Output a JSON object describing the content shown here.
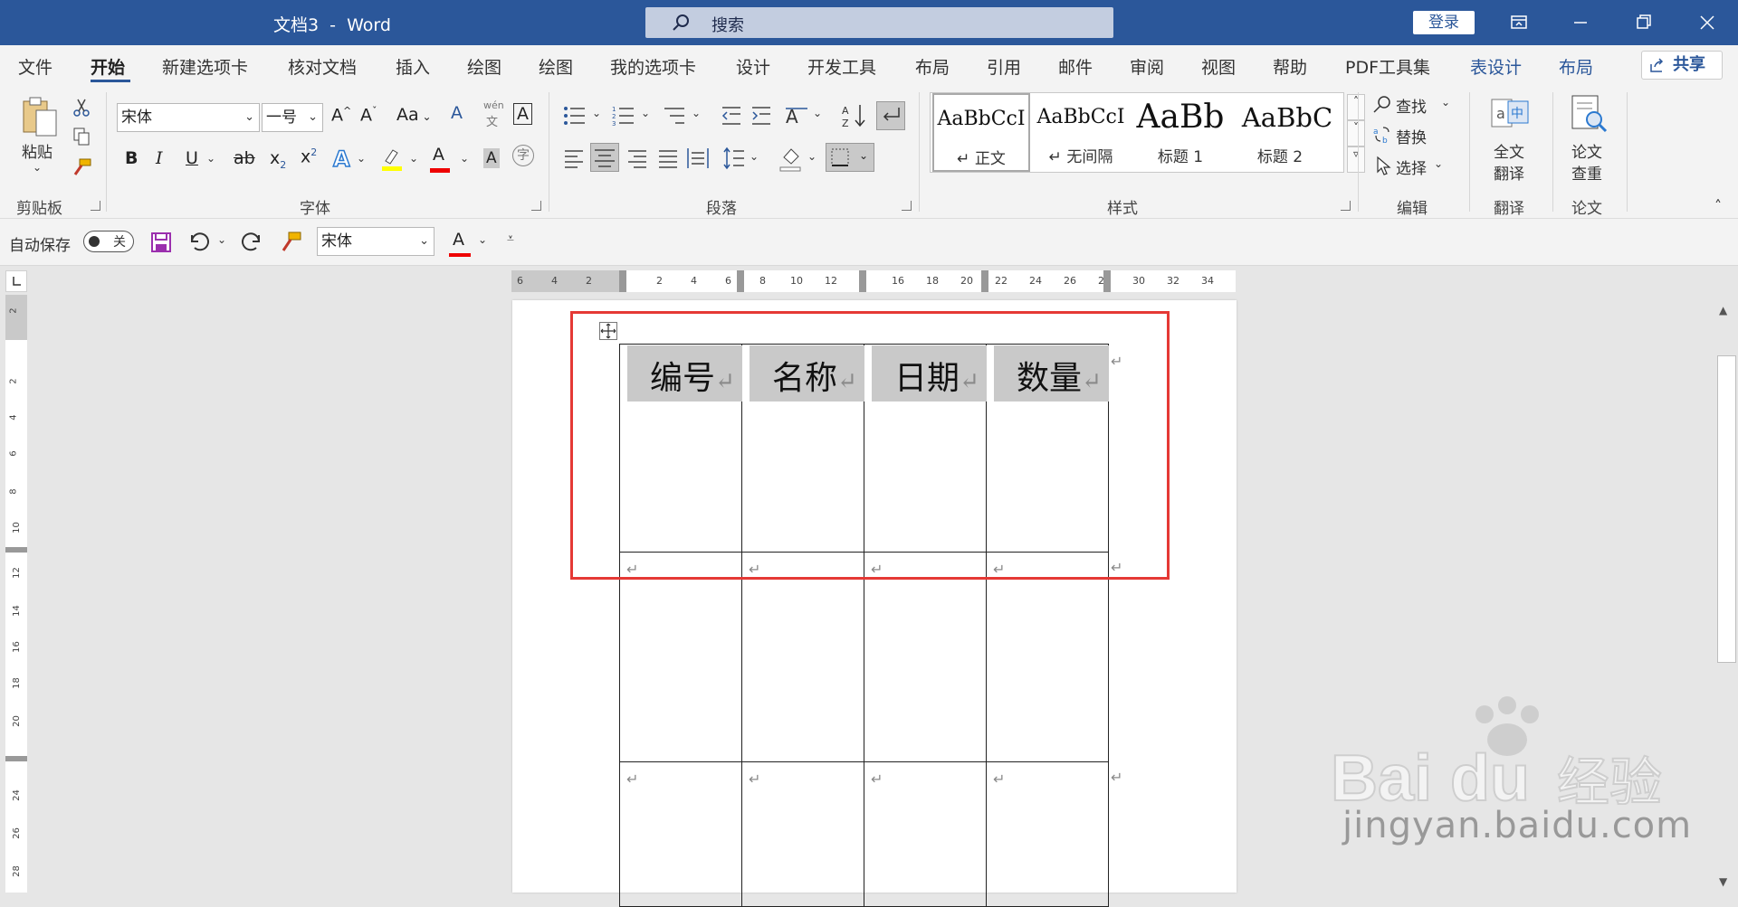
{
  "title_bar": {
    "title": "文档3  -  Word",
    "search_placeholder": "搜索",
    "login_label": "登录"
  },
  "tabs": [
    "文件",
    "开始",
    "新建选项卡",
    "核对文档",
    "插入",
    "绘图",
    "绘图",
    "我的选项卡",
    "设计",
    "开发工具",
    "布局",
    "引用",
    "邮件",
    "审阅",
    "视图",
    "帮助",
    "PDF工具集",
    "表设计",
    "布局"
  ],
  "active_tab": "开始",
  "share_label": "共享",
  "ribbon": {
    "clipboard": {
      "paste_label": "粘贴",
      "group_label": "剪贴板"
    },
    "font": {
      "font_name": "宋体",
      "font_size": "一号",
      "group_label": "字体",
      "size_up": "A",
      "size_down": "A",
      "change_case": "Aa",
      "bold": "B",
      "italic": "I",
      "underline": "U",
      "strike": "ab",
      "subscript": "x",
      "superscript": "x",
      "phonetic_top": "wén",
      "phonetic_bottom": "文"
    },
    "paragraph": {
      "group_label": "段落"
    },
    "styles": {
      "group_label": "样式",
      "items": [
        {
          "sample": "AaBbCcI",
          "name": "↵ 正文"
        },
        {
          "sample": "AaBbCcI",
          "name": "↵ 无间隔"
        },
        {
          "sample": "AaBb",
          "name": "标题 1"
        },
        {
          "sample": "AaBbC",
          "name": "标题 2"
        }
      ]
    },
    "editing": {
      "find": "查找",
      "replace": "替换",
      "select": "选择",
      "group_label": "编辑"
    },
    "translate": {
      "button": "全文\n翻译",
      "line1": "全文",
      "line2": "翻译",
      "group_label": "翻译"
    },
    "paper": {
      "line1": "论文",
      "line2": "查重",
      "group_label": "论文"
    }
  },
  "qat": {
    "autosave_label": "自动保存",
    "autosave_state": "关",
    "font_name": "宋体",
    "font_color_letter": "A"
  },
  "ruler": {
    "h_labels": [
      "6",
      "4",
      "2",
      "2",
      "4",
      "6",
      "8",
      "10",
      "12",
      "16",
      "18",
      "20",
      "22",
      "24",
      "26",
      "28",
      "30",
      "32",
      "34"
    ],
    "v_labels": [
      "2",
      "2",
      "4",
      "6",
      "8",
      "10",
      "12",
      "14",
      "16",
      "18",
      "20",
      "24",
      "26",
      "28"
    ]
  },
  "document": {
    "table_headers": [
      "编号",
      "名称",
      "日期",
      "数量"
    ],
    "return_mark": "↵"
  },
  "watermark": {
    "brand": "Baidu经验",
    "url": "jingyan.baidu.com"
  },
  "colors": {
    "title_bar": "#2b579a",
    "highlight_box": "#e53935",
    "header_shade": "#c9c9c9"
  }
}
